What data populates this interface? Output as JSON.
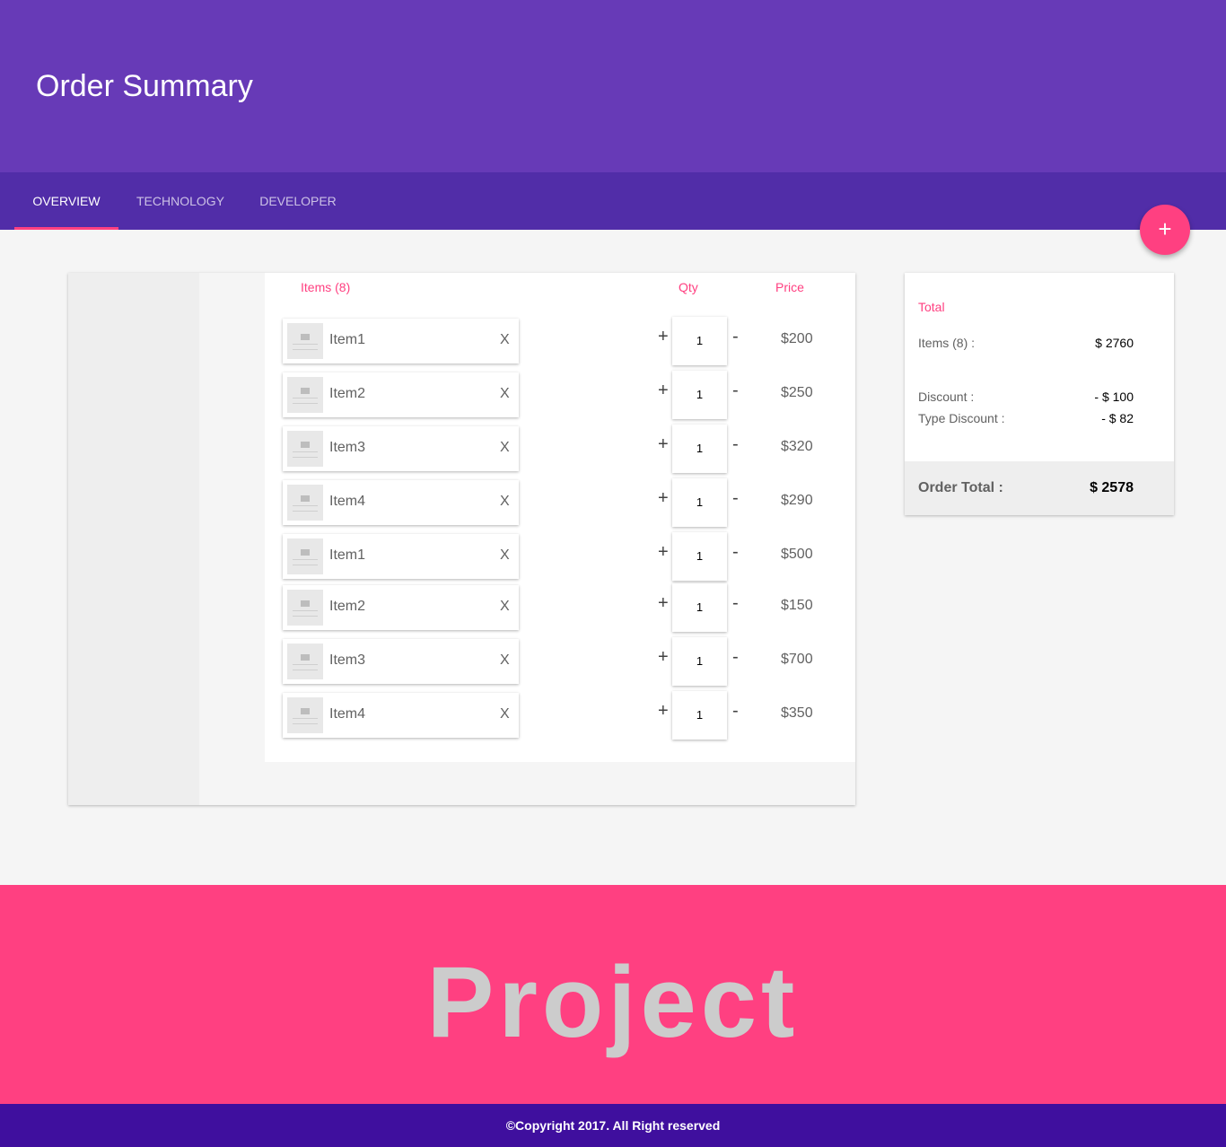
{
  "header": {
    "title": "Order Summary"
  },
  "tabs": [
    {
      "label": "OVERVIEW"
    },
    {
      "label": "TECHNOLOGY"
    },
    {
      "label": "DEVELOPER"
    }
  ],
  "fab": {
    "icon": "plus-icon",
    "label": "+"
  },
  "cart": {
    "headers": {
      "items": "Items (8)",
      "qty": "Qty",
      "price": "Price"
    },
    "remove_label": "X",
    "plus_label": "+",
    "minus_label": "-",
    "items": [
      {
        "name": "Item1",
        "qty": "1",
        "price": "$200"
      },
      {
        "name": "Item2",
        "qty": "1",
        "price": "$250"
      },
      {
        "name": "Item3",
        "qty": "1",
        "price": "$320"
      },
      {
        "name": "Item4",
        "qty": "1",
        "price": "$290"
      },
      {
        "name": "Item1",
        "qty": "1",
        "price": "$500"
      },
      {
        "name": "Item2",
        "qty": "1",
        "price": "$150"
      },
      {
        "name": "Item3",
        "qty": "1",
        "price": "$700"
      },
      {
        "name": "Item4",
        "qty": "1",
        "price": "$350"
      }
    ]
  },
  "summary": {
    "title": "Total",
    "items_label": "Items (8) :",
    "items_value": "$ 2760",
    "discount_label": "Discount :",
    "discount_value": "- $ 100",
    "type_discount_label": "Type Discount :",
    "type_discount_value": "- $ 82",
    "order_total_label": "Order Total :",
    "order_total_value": "$ 2578"
  },
  "banner": {
    "text": "Project"
  },
  "footer": {
    "copyright": "©Copyright 2017. All Right reserved"
  },
  "colors": {
    "header": "#673ab7",
    "tabs": "#512da8",
    "accent": "#ff4081",
    "footer": "#3f0f9e"
  }
}
